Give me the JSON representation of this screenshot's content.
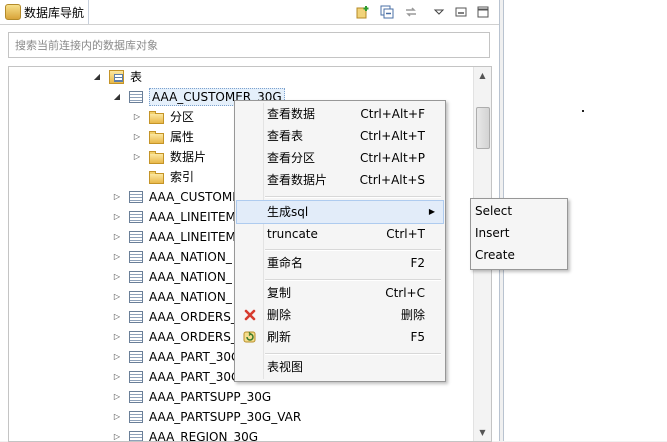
{
  "view": {
    "title": "数据库导航",
    "search_placeholder": "搜索当前连接内的数据库对象"
  },
  "toolbar": {
    "icons": [
      "new-connection-icon",
      "collapse-all-icon",
      "link-editor-icon",
      "view-menu-icon",
      "minimize-icon",
      "maximize-icon"
    ]
  },
  "tree": {
    "tables_node": "表",
    "selected_table": "AAA_CUSTOMER_30G",
    "children": [
      "分区",
      "属性",
      "数据片",
      "索引"
    ],
    "tables": [
      "AAA_CUSTOMI",
      "AAA_LINEITEM",
      "AAA_LINEITEM",
      "AAA_NATION_",
      "AAA_NATION_",
      "AAA_NATION_",
      "AAA_ORDERS_",
      "AAA_ORDERS_",
      "AAA_PART_30G",
      "AAA_PART_30G",
      "AAA_PARTSUPP_30G",
      "AAA_PARTSUPP_30G_VAR",
      "AAA_REGION_30G"
    ]
  },
  "context_menu": {
    "items": [
      {
        "label": "查看数据",
        "shortcut": "Ctrl+Alt+F"
      },
      {
        "label": "查看表",
        "shortcut": "Ctrl+Alt+T"
      },
      {
        "label": "查看分区",
        "shortcut": "Ctrl+Alt+P"
      },
      {
        "label": "查看数据片",
        "shortcut": "Ctrl+Alt+S"
      },
      {
        "label": "生成sql",
        "shortcut": ""
      },
      {
        "label": "truncate",
        "shortcut": "Ctrl+T"
      },
      {
        "label": "重命名",
        "shortcut": "F2"
      },
      {
        "label": "复制",
        "shortcut": "Ctrl+C"
      },
      {
        "label": "删除",
        "shortcut": "删除"
      },
      {
        "label": "刷新",
        "shortcut": "F5"
      },
      {
        "label": "表视图",
        "shortcut": ""
      }
    ]
  },
  "submenu": {
    "items": [
      "Select",
      "Insert",
      "Create"
    ]
  },
  "colors": {
    "hover_bg": "#e2ecf9",
    "selection_border": "#7da2ce",
    "delete_icon": "#d63b2f"
  }
}
